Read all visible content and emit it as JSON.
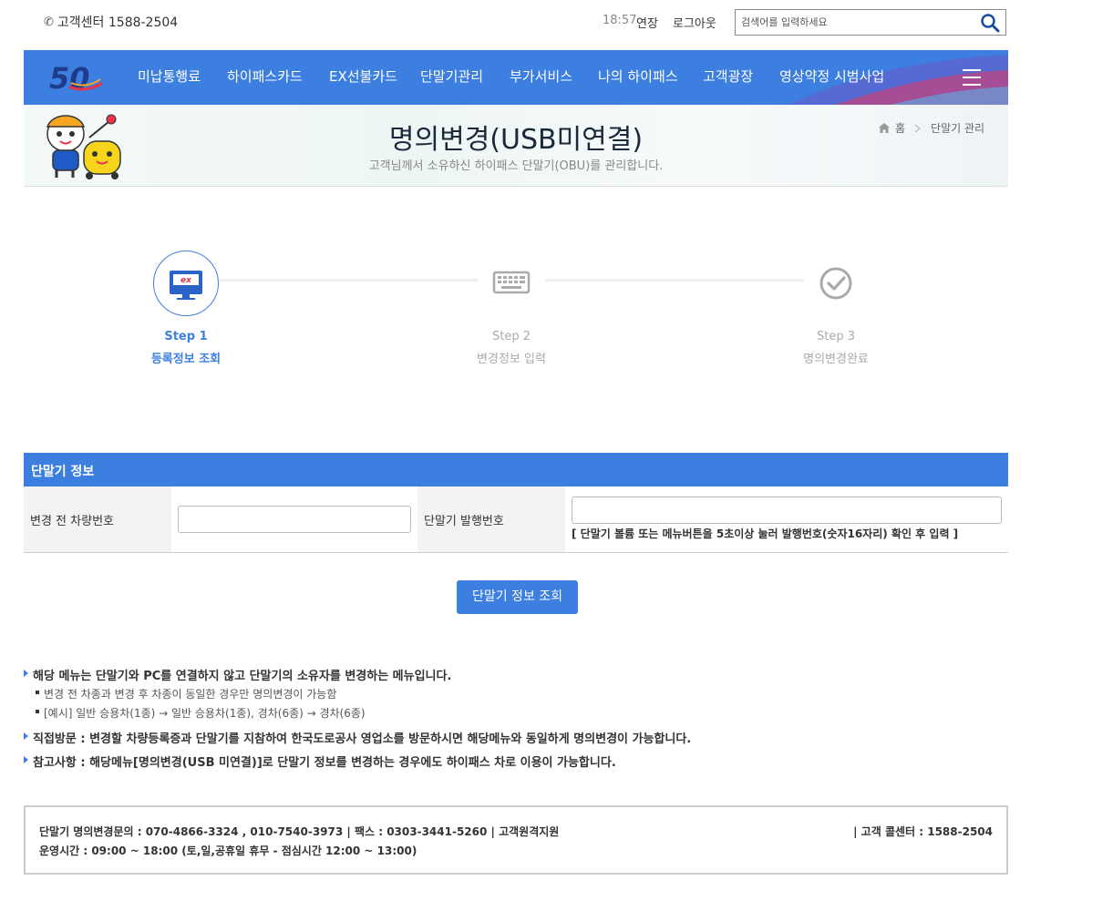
{
  "topbar": {
    "customer_center": "고객센터 1588-2504",
    "session_time": "18:57",
    "extend_label": "연장",
    "logout_label": "로그아웃",
    "search_placeholder": "검색어를 입력하세요"
  },
  "logo": {
    "text": "50"
  },
  "gnb": {
    "items": [
      "미납통행료",
      "하이패스카드",
      "EX선불카드",
      "단말기관리",
      "부가서비스",
      "나의 하이패스",
      "고객광장",
      "영상약정 시범사업"
    ]
  },
  "page": {
    "title": "명의변경(USB미연결)",
    "subtitle": "고객님께서 소유하신 하이패스 단말기(OBU)를 관리합니다.",
    "breadcrumb": [
      "홈",
      "단말기 관리"
    ]
  },
  "steps": [
    {
      "label": "Step 1",
      "name": "등록정보 조회",
      "active": true
    },
    {
      "label": "Step 2",
      "name": "변경정보 입력",
      "active": false
    },
    {
      "label": "Step 3",
      "name": "명의변경완료",
      "active": false
    }
  ],
  "section": {
    "title": "단말기 정보",
    "field_plate_label": "변경 전 차량번호",
    "field_plate_value": "",
    "field_obu_label": "단말기 발행번호",
    "field_obu_value": "",
    "obu_note": "[ 단말기 볼륨 또는 메뉴버튼을 5초이상 눌러 발행번호(숫자16자리) 확인 후 입력 ]",
    "query_button": "단말기 정보 조회"
  },
  "notes": {
    "n1": "해당 메뉴는 단말기와 PC를 연결하지 않고 단말기의 소유자를 변경하는 메뉴입니다.",
    "n1_sub1": "변경 전 차종과 변경 후 차종이 동일한 경우만 명의변경이 가능함",
    "n1_sub2": "[예시] 일반 승용차(1종) → 일반 승용차(1종), 경차(6종) → 경차(6종)",
    "n2": "직접방문 : 변경할 차량등록증과 단말기를 지참하여 한국도로공사 영업소를 방문하시면 해당메뉴와 동일하게 명의변경이 가능합니다.",
    "n3": "참고사항 : 해당메뉴[명의변경(USB 미연결)]로 단말기 정보를 변경하는 경우에도 하이패스 차로 이용이 가능합니다."
  },
  "footer": {
    "line1": "단말기 명의변경문의 : 070-4866-3324 , 010-7540-3973  |  팩스 : 0303-3441-5260  |  고객원격지원",
    "line2": "운영시간 : 09:00 ~ 18:00 (토,일,공휴일 휴무 - 점심시간 12:00 ~ 13:00)",
    "callcenter": "|   고객 콜센터 : 1588-2504"
  },
  "colors": {
    "brand_blue": "#3d7fe0",
    "step_active": "#3d7fe0",
    "step_inactive": "#aaaaaa"
  },
  "icons": [
    "phone-icon",
    "search-icon",
    "hamburger-icon",
    "home-icon",
    "chevron-right-icon",
    "monitor-ex-icon",
    "keyboard-icon",
    "check-circle-icon"
  ]
}
